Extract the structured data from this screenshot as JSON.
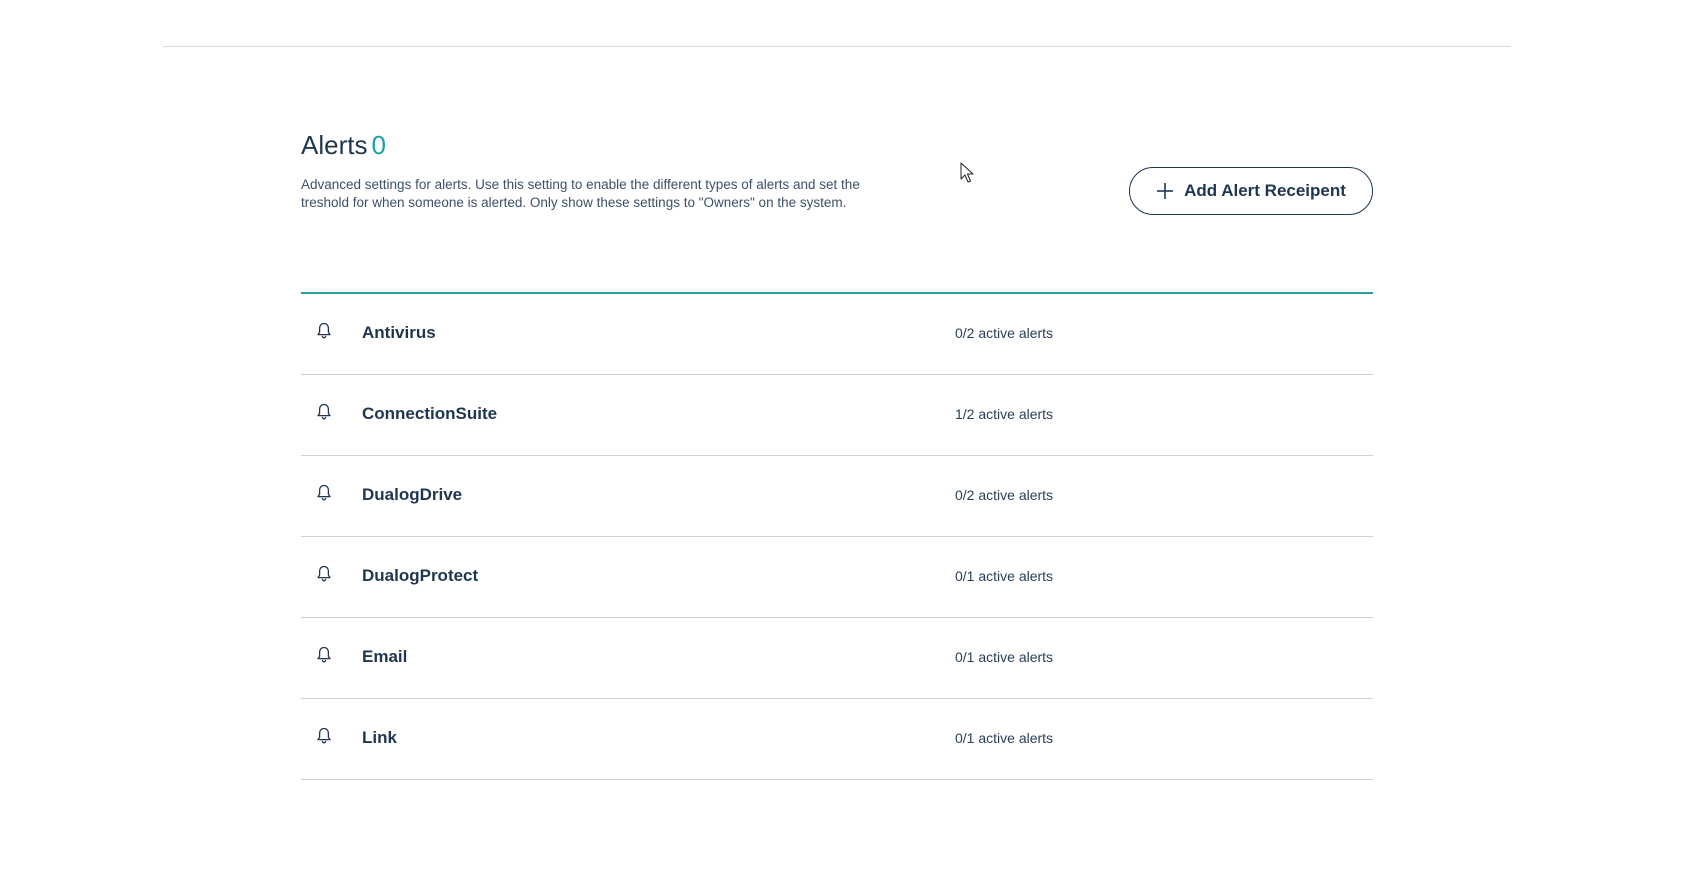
{
  "header": {
    "title": "Alerts",
    "count": "0",
    "description": "Advanced settings for alerts. Use this setting to enable the different types of alerts and set the treshold for when someone is alerted. Only show these settings to \"Owners\" on the system.",
    "add_button_label": "Add Alert Receipent",
    "add_button_icon": "plus-icon"
  },
  "alerts": [
    {
      "name": "Antivirus",
      "status": "0/2 active alerts",
      "icon": "bell-icon"
    },
    {
      "name": "ConnectionSuite",
      "status": "1/2 active alerts",
      "icon": "bell-icon"
    },
    {
      "name": "DualogDrive",
      "status": "0/2 active alerts",
      "icon": "bell-icon"
    },
    {
      "name": "DualogProtect",
      "status": "0/1 active alerts",
      "icon": "bell-icon"
    },
    {
      "name": "Email",
      "status": "0/1 active alerts",
      "icon": "bell-icon"
    },
    {
      "name": "Link",
      "status": "0/1 active alerts",
      "icon": "bell-icon"
    }
  ],
  "colors": {
    "primary_text": "#1f3650",
    "accent": "#1aa0a6",
    "list_top_border": "#2aa39c",
    "row_divider": "#c9d3dc"
  }
}
